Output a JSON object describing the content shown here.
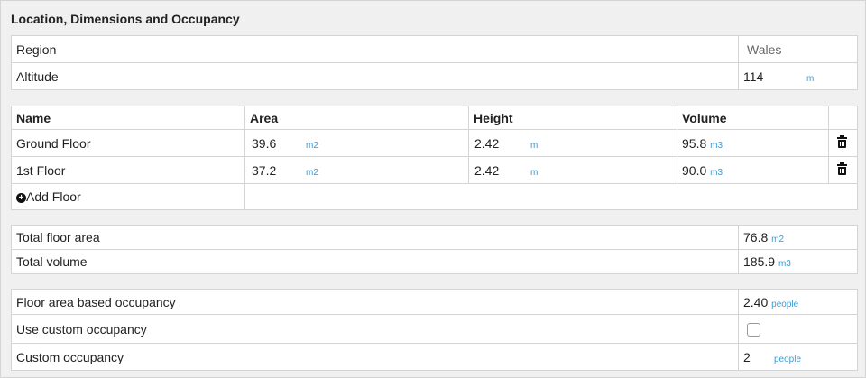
{
  "section": {
    "title": "Location, Dimensions and Occupancy"
  },
  "location": {
    "region_label": "Region",
    "region_value": "Wales",
    "altitude_label": "Altitude",
    "altitude_value": "114",
    "altitude_unit": "m"
  },
  "floors": {
    "headers": {
      "name": "Name",
      "area": "Area",
      "height": "Height",
      "volume": "Volume"
    },
    "rows": [
      {
        "name": "Ground Floor",
        "area": "39.6",
        "area_unit": "m2",
        "height": "2.42",
        "height_unit": "m",
        "volume": "95.8",
        "volume_unit": "m3"
      },
      {
        "name": "1st Floor",
        "area": "37.2",
        "area_unit": "m2",
        "height": "2.42",
        "height_unit": "m",
        "volume": "90.0",
        "volume_unit": "m3"
      }
    ],
    "add_label": "Add Floor"
  },
  "totals": {
    "floor_area_label": "Total floor area",
    "floor_area_value": "76.8",
    "floor_area_unit": "m2",
    "volume_label": "Total volume",
    "volume_value": "185.9",
    "volume_unit": "m3"
  },
  "occupancy": {
    "floor_based_label": "Floor area based occupancy",
    "floor_based_value": "2.40",
    "floor_based_unit": "people",
    "use_custom_label": "Use custom occupancy",
    "use_custom_checked": false,
    "custom_label": "Custom occupancy",
    "custom_value": "2",
    "custom_unit": "people"
  },
  "icons": {
    "delete": "trash-icon",
    "add": "plus-circle-icon"
  },
  "colors": {
    "unit": "#3a9bd5",
    "border": "#d4d4d4",
    "background": "#f0f0f0"
  }
}
